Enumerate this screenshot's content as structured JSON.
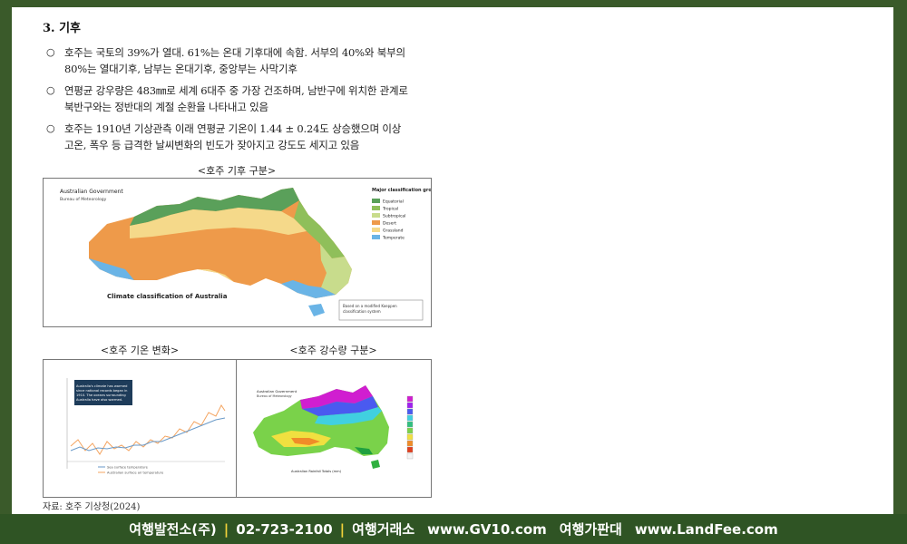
{
  "heading": "3. 기후",
  "bullets": [
    {
      "line1": "호주는 국토의 39%가 열대. 61%는 온대 기후대에 속함. 서부의 40%와 북부의",
      "line2": "80%는 열대기후, 남부는 온대기후, 중앙부는 사막기후"
    },
    {
      "line1": "연평균 강우량은 483㎜로 세계 6대주 중 가장 건조하며, 남반구에 위치한 관계로",
      "line2": "북반구와는 정반대의 계절 순환을 나타내고 있음"
    },
    {
      "line1": "호주는 1910년 기상관측 이래 연평균 기온이 1.44 ± 0.24도 상승했으며 이상",
      "line2": "고온, 폭우 등 급격한 날씨변화의 빈도가 잦아지고 강도도 세지고 있음"
    }
  ],
  "bullet_mark": "○",
  "map1": {
    "caption": "<호주 기후 구분>",
    "gov": "Australian Government",
    "bureau": "Bureau of Meteorology",
    "title": "Climate classification of Australia",
    "legend_title": "Major classification groups",
    "legend": [
      {
        "label": "Equatorial",
        "color": "#5aa05a"
      },
      {
        "label": "Tropical",
        "color": "#8fbf5a"
      },
      {
        "label": "Subtropical",
        "color": "#c8dc8c"
      },
      {
        "label": "Desert",
        "color": "#ee9a4a"
      },
      {
        "label": "Grassland",
        "color": "#f5d98a"
      },
      {
        "label": "Temperate",
        "color": "#6ab4e6"
      }
    ],
    "note": "Based on a modified Koeppen classification system"
  },
  "temp": {
    "caption": "<호주 기온 변화>",
    "note": "Australia's climate has warmed since national records began in 1910. The oceans surrounding Australia have also warmed.",
    "legend1": "Sea surface temperature",
    "legend2": "Australian surface air temperature"
  },
  "rain": {
    "caption": "<호주 강수량 구분>",
    "gov": "Australian Government",
    "bureau": "Bureau of Meteorology",
    "title": "Australian Rainfall Totals (mm)"
  },
  "source": "자료: 호주 기상청(2024)",
  "footer": {
    "company": "여행발전소(주)",
    "phone": "02-723-2100",
    "exchange": "여행거래소",
    "url1": "www.GV10.com",
    "board": "여행가판대",
    "url2": "www.LandFee.com"
  },
  "colors": {
    "frame": "#3a5a2a",
    "footer": "#2f5424",
    "accent": "#f2d23a"
  }
}
